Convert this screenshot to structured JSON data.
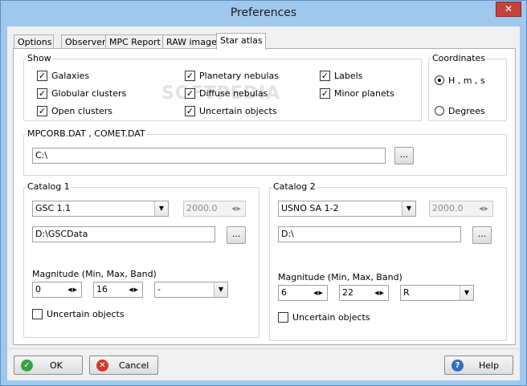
{
  "window": {
    "title": "Preferences",
    "close_glyph": "✕"
  },
  "tabs": [
    {
      "label": "Options"
    },
    {
      "label": "Observer"
    },
    {
      "label": "MPC Report"
    },
    {
      "label": "RAW images"
    },
    {
      "label": "Star atlas",
      "active": true
    }
  ],
  "watermark": "SOFTPEDIA",
  "show": {
    "legend": "Show",
    "items": [
      {
        "label": "Galaxies",
        "checked": true
      },
      {
        "label": "Globular clusters",
        "checked": true
      },
      {
        "label": "Open clusters",
        "checked": true
      },
      {
        "label": "Planetary nebulas",
        "checked": true
      },
      {
        "label": "Diffuse nebulas",
        "checked": true
      },
      {
        "label": "Uncertain objects",
        "checked": true
      },
      {
        "label": "Labels",
        "checked": true
      },
      {
        "label": "Minor planets",
        "checked": true
      }
    ]
  },
  "coordinates": {
    "legend": "Coordinates",
    "options": [
      {
        "label": "H , m , s",
        "selected": true
      },
      {
        "label": "Degrees",
        "selected": false
      }
    ]
  },
  "mpcorb": {
    "legend": "MPCORB.DAT , COMET.DAT",
    "path": "C:\\",
    "browse_label": "..."
  },
  "catalog1": {
    "legend": "Catalog 1",
    "catalog": "GSC 1.1",
    "epoch": "2000.0",
    "path": "D:\\GSCData",
    "browse_label": "...",
    "magnitude_label": "Magnitude (Min, Max, Band)",
    "mag_min": "0",
    "mag_max": "16",
    "band": "-",
    "uncertain_label": "Uncertain objects",
    "uncertain_checked": false
  },
  "catalog2": {
    "legend": "Catalog 2",
    "catalog": "USNO SA 1-2",
    "epoch": "2000.0",
    "path": "D:\\",
    "browse_label": "...",
    "magnitude_label": "Magnitude (Min, Max, Band)",
    "mag_min": "6",
    "mag_max": "22",
    "band": "R",
    "uncertain_label": "Uncertain objects",
    "uncertain_checked": false
  },
  "buttons": {
    "ok": "OK",
    "cancel": "Cancel",
    "help": "Help",
    "ok_icon": "✓",
    "cancel_icon": "✕",
    "help_icon": "?"
  },
  "icons": {
    "check": "✓",
    "combo_arrow": "▼",
    "spin_arrows": "◀▶"
  },
  "colors": {
    "titlebar": "#9fc8ec",
    "close": "#c7423a",
    "ok_icon": "#3aa046",
    "cancel_icon": "#d03a2e",
    "help_icon": "#2f6fc0"
  }
}
